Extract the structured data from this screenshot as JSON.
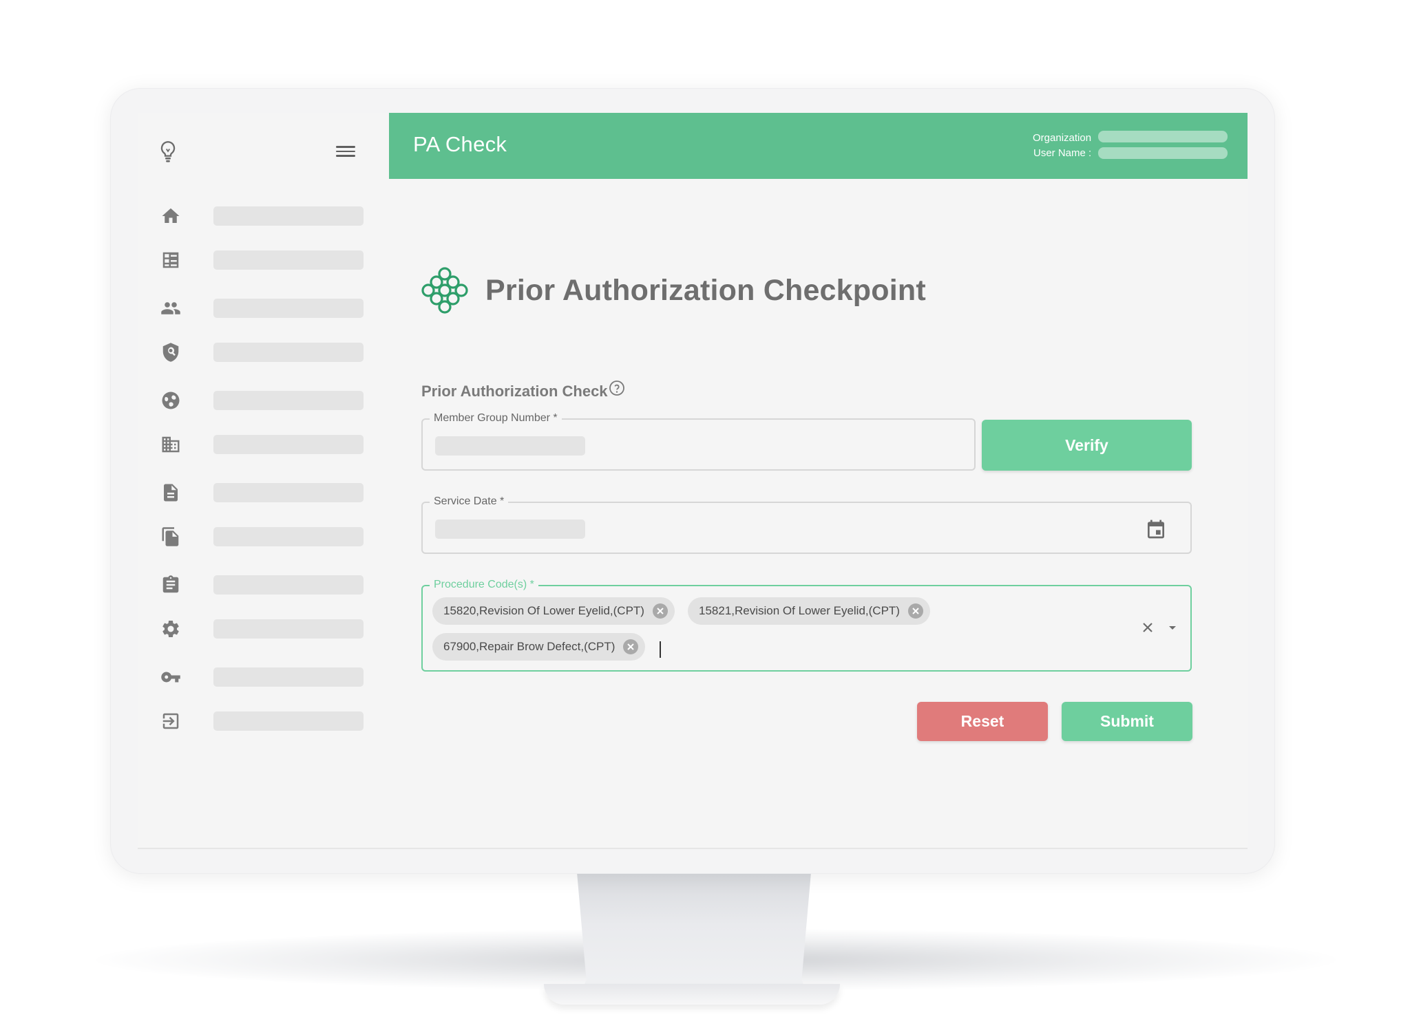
{
  "header": {
    "app_title": "PA Check",
    "organization_label": "Organization",
    "user_name_label": "User Name :"
  },
  "sidebar": {
    "logo_icon": "lightbulb-icon",
    "menu_icon": "hamburger-menu-icon",
    "items": [
      {
        "icon": "home-icon"
      },
      {
        "icon": "dashboard-icon"
      },
      {
        "icon": "people-icon"
      },
      {
        "icon": "shield-icon"
      },
      {
        "icon": "globe-icon"
      },
      {
        "icon": "building-icon"
      },
      {
        "icon": "document-icon"
      },
      {
        "icon": "copy-files-icon"
      },
      {
        "icon": "clipboard-icon"
      },
      {
        "icon": "gear-icon"
      },
      {
        "icon": "key-icon"
      },
      {
        "icon": "logout-icon"
      }
    ]
  },
  "main": {
    "page_title": "Prior Authorization Checkpoint",
    "section_title": "Prior Authorization Check",
    "member_group_label": "Member Group Number *",
    "verify_label": "Verify",
    "service_date_label": "Service Date *",
    "procedure_label": "Procedure Code(s) *",
    "procedure_chips": [
      "15820,Revision Of Lower Eyelid,(CPT)",
      "15821,Revision Of Lower Eyelid,(CPT)",
      "67900,Repair Brow Defect,(CPT)"
    ],
    "reset_label": "Reset",
    "submit_label": "Submit"
  },
  "colors": {
    "brand_green": "#5ebf8f",
    "button_green": "#6ecf9e",
    "reset_red": "#e07b7b",
    "logo_green": "#2e9e6a"
  }
}
